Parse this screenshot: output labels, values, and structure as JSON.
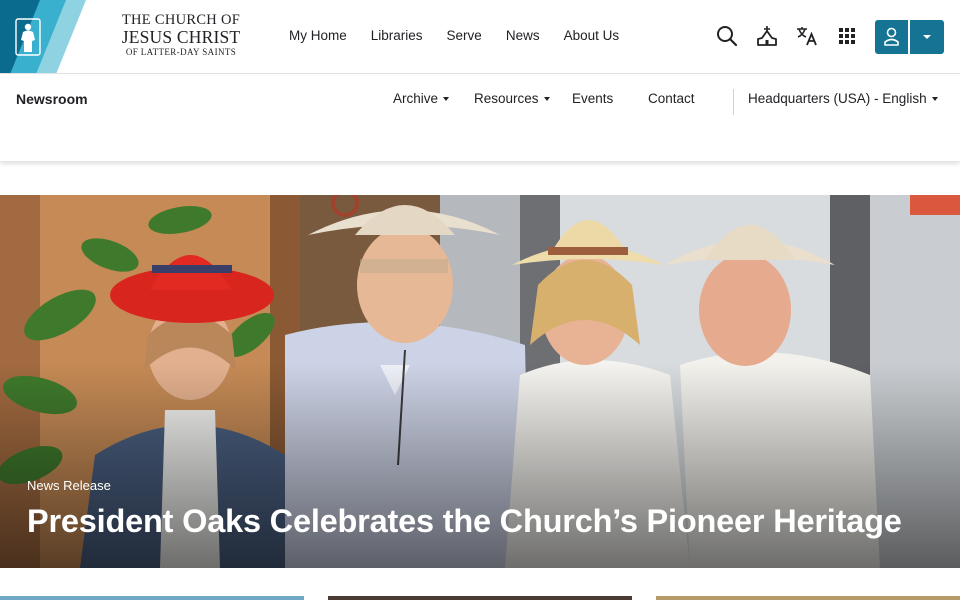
{
  "header": {
    "church_name_line1": "THE CHURCH OF",
    "church_name_line2": "JESUS CHRIST",
    "church_name_line3": "OF LATTER-DAY SAINTS",
    "nav": [
      {
        "label": "My Home"
      },
      {
        "label": "Libraries"
      },
      {
        "label": "Serve"
      },
      {
        "label": "News"
      },
      {
        "label": "About Us"
      }
    ],
    "icons": [
      "search-icon",
      "meetinghouse-icon",
      "translate-icon",
      "apps-grid-icon",
      "account-icon",
      "chevron-down-icon"
    ],
    "accent_color": "#157493"
  },
  "subnav": {
    "title": "Newsroom",
    "links": [
      {
        "label": "Archive",
        "dropdown": true
      },
      {
        "label": "Resources",
        "dropdown": true
      },
      {
        "label": "Events",
        "dropdown": false
      },
      {
        "label": "Contact",
        "dropdown": false
      }
    ],
    "region": "Headquarters (USA) - English"
  },
  "hero": {
    "kicker": "News Release",
    "headline": "President Oaks Celebrates the Church’s Pioneer Heritage"
  }
}
